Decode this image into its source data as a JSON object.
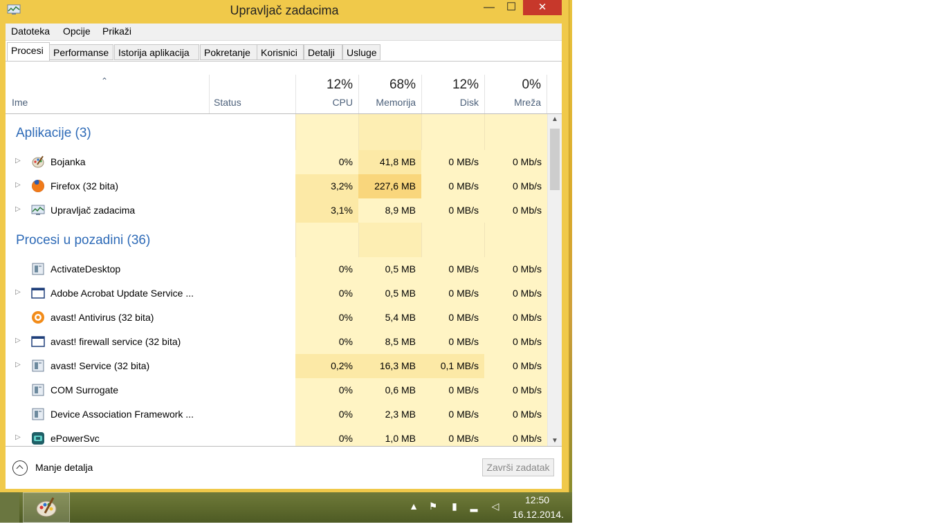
{
  "window": {
    "title": "Upravljač zadacima",
    "min_glyph": "—",
    "max_glyph": "☐",
    "close_glyph": "✕"
  },
  "menu": {
    "items": [
      "Datoteka",
      "Opcije",
      "Prikaži"
    ]
  },
  "tabs": {
    "items": [
      "Procesi",
      "Performanse",
      "Istorija aplikacija",
      "Pokretanje",
      "Korisnici",
      "Detalji",
      "Usluge"
    ],
    "active": "Procesi"
  },
  "columns": {
    "name": "Ime",
    "status": "Status",
    "cpu": {
      "label": "CPU",
      "percent": "12%"
    },
    "memory": {
      "label": "Memorija",
      "percent": "68%"
    },
    "disk": {
      "label": "Disk",
      "percent": "12%"
    },
    "network": {
      "label": "Mreža",
      "percent": "0%"
    }
  },
  "groups": {
    "apps": "Aplikacije (3)",
    "background": "Procesi u pozadini (36)"
  },
  "rows": [
    {
      "name": "Bojanka",
      "icon": "paint-icon",
      "expandable": true,
      "cpu": "0%",
      "mem": "41,8 MB",
      "disk": "0 MB/s",
      "net": "0 Mb/s"
    },
    {
      "name": "Firefox (32 bita)",
      "icon": "firefox-icon",
      "expandable": true,
      "cpu": "3,2%",
      "mem": "227,6 MB",
      "disk": "0 MB/s",
      "net": "0 Mb/s"
    },
    {
      "name": "Upravljač zadacima",
      "icon": "task-manager-icon",
      "expandable": true,
      "cpu": "3,1%",
      "mem": "8,9 MB",
      "disk": "0 MB/s",
      "net": "0 Mb/s"
    },
    {
      "name": "ActivateDesktop",
      "icon": "service-icon",
      "expandable": false,
      "cpu": "0%",
      "mem": "0,5 MB",
      "disk": "0 MB/s",
      "net": "0 Mb/s"
    },
    {
      "name": "Adobe Acrobat Update Service ...",
      "icon": "window-icon",
      "expandable": true,
      "cpu": "0%",
      "mem": "0,5 MB",
      "disk": "0 MB/s",
      "net": "0 Mb/s"
    },
    {
      "name": "avast! Antivirus (32 bita)",
      "icon": "avast-icon",
      "expandable": false,
      "cpu": "0%",
      "mem": "5,4 MB",
      "disk": "0 MB/s",
      "net": "0 Mb/s"
    },
    {
      "name": "avast! firewall service (32 bita)",
      "icon": "window-icon",
      "expandable": true,
      "cpu": "0%",
      "mem": "8,5 MB",
      "disk": "0 MB/s",
      "net": "0 Mb/s"
    },
    {
      "name": "avast! Service (32 bita)",
      "icon": "service-icon",
      "expandable": true,
      "cpu": "0,2%",
      "mem": "16,3 MB",
      "disk": "0,1 MB/s",
      "net": "0 Mb/s"
    },
    {
      "name": "COM Surrogate",
      "icon": "service-icon",
      "expandable": false,
      "cpu": "0%",
      "mem": "0,6 MB",
      "disk": "0 MB/s",
      "net": "0 Mb/s"
    },
    {
      "name": "Device Association Framework ...",
      "icon": "service-icon",
      "expandable": false,
      "cpu": "0%",
      "mem": "2,3 MB",
      "disk": "0 MB/s",
      "net": "0 Mb/s"
    },
    {
      "name": "ePowerSvc",
      "icon": "epower-icon",
      "expandable": true,
      "cpu": "0%",
      "mem": "1,0 MB",
      "disk": "0 MB/s",
      "net": "0 Mb/s"
    }
  ],
  "footer": {
    "less_details": "Manje detalja",
    "end_task": "Završi zadatak"
  },
  "taskbar": {
    "time": "12:50",
    "date": "16.12.2014."
  },
  "colors": {
    "title_bar": "#f0c94a",
    "close_button": "#c7382b",
    "group_heading": "#2d6ab7",
    "heat_low": "#fff4c4",
    "heat_mid": "#fce9a6",
    "heat_high": "#f9d67c"
  }
}
